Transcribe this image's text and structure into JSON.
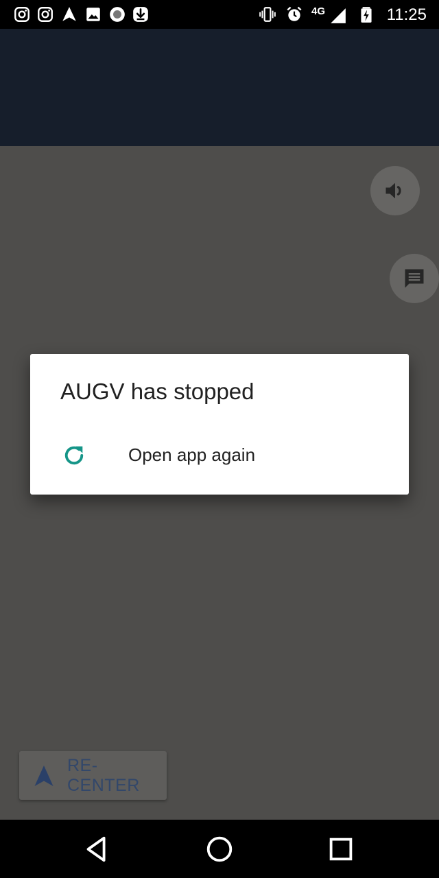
{
  "status_bar": {
    "time": "11:25",
    "network": "4G",
    "left_icons": [
      "instagram-icon",
      "instagram-icon",
      "navigation-icon",
      "image-icon",
      "record-icon",
      "download-icon"
    ],
    "right_icons": [
      "vibrate-icon",
      "alarm-icon",
      "signal-icon",
      "battery-charging-icon"
    ]
  },
  "map": {
    "sound_button_icon": "volume-icon",
    "chat_button_icon": "message-icon",
    "recenter_label": "RE-CENTER",
    "recenter_icon": "navigation-arrow-icon"
  },
  "dialog": {
    "title": "AUGV has stopped",
    "option_label": "Open app again",
    "option_icon": "reload-icon",
    "accent_color": "#159588"
  },
  "nav_bar": {
    "buttons": [
      "back-icon",
      "home-icon",
      "recents-icon"
    ]
  }
}
